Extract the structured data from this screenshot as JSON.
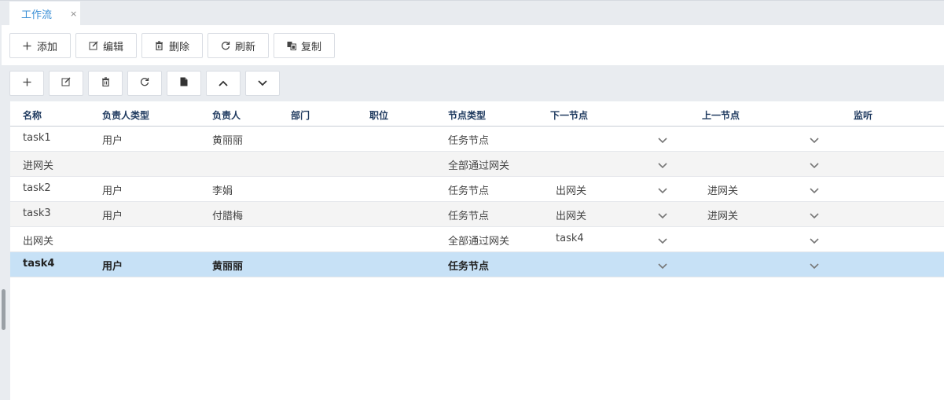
{
  "tabs": [
    {
      "label": "工作流",
      "close": "×"
    }
  ],
  "toolbar": {
    "add": "添加",
    "edit": "编辑",
    "delete": "删除",
    "refresh": "刷新",
    "copy": "复制"
  },
  "grid": {
    "headers": [
      "名称",
      "负责人类型",
      "负责人",
      "部门",
      "职位",
      "节点类型",
      "下一节点",
      "上一节点",
      "监听"
    ],
    "rows": [
      {
        "name": "task1",
        "owner_type": "用户",
        "owner": "黄丽丽",
        "dept": "",
        "position": "",
        "node_type": "任务节点",
        "next": "",
        "prev": ""
      },
      {
        "name": "进网关",
        "owner_type": "",
        "owner": "",
        "dept": "",
        "position": "",
        "node_type": "全部通过网关",
        "next": "",
        "prev": ""
      },
      {
        "name": "task2",
        "owner_type": "用户",
        "owner": "李娟",
        "dept": "",
        "position": "",
        "node_type": "任务节点",
        "next": "出网关",
        "prev": "进网关"
      },
      {
        "name": "task3",
        "owner_type": "用户",
        "owner": "付腊梅",
        "dept": "",
        "position": "",
        "node_type": "任务节点",
        "next": "出网关",
        "prev": "进网关"
      },
      {
        "name": "出网关",
        "owner_type": "",
        "owner": "",
        "dept": "",
        "position": "",
        "node_type": "全部通过网关",
        "next": "task4",
        "prev": ""
      },
      {
        "name": "task4",
        "owner_type": "用户",
        "owner": "黄丽丽",
        "dept": "",
        "position": "",
        "node_type": "任务节点",
        "next": "",
        "prev": ""
      }
    ],
    "selected_row": 5
  }
}
